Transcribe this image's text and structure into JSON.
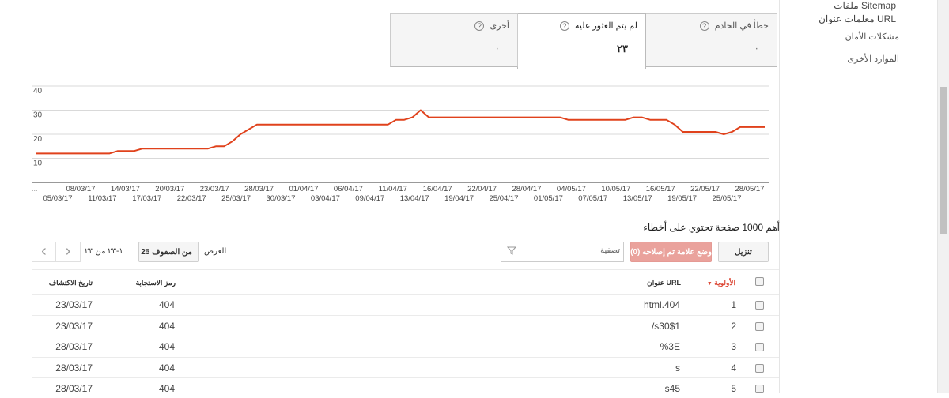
{
  "sidebar": {
    "items": [
      {
        "label": "ملفات Sitemap"
      },
      {
        "label": "معلمات عنوان URL"
      },
      {
        "label": "مشكلات الأمان"
      },
      {
        "label": "الموارد الأخرى"
      }
    ]
  },
  "tabs": [
    {
      "label": "خطأ في الخادم",
      "value": "٠",
      "selected": false
    },
    {
      "label": "لم يتم العثور عليه",
      "value": "٢٣",
      "selected": true
    },
    {
      "label": "أخرى",
      "value": "٠",
      "selected": false
    }
  ],
  "help_glyph": "?",
  "chart_data": {
    "type": "line",
    "color": "#e0421c",
    "ylim": [
      0,
      40
    ],
    "yticks": [
      "10",
      "20",
      "30",
      "40"
    ],
    "grid": true,
    "x_ellipsis": "...",
    "xticks_top": [
      "08/03/17",
      "14/03/17",
      "20/03/17",
      "23/03/17",
      "28/03/17",
      "01/04/17",
      "06/04/17",
      "11/04/17",
      "16/04/17",
      "22/04/17",
      "28/04/17",
      "04/05/17",
      "10/05/17",
      "16/05/17",
      "22/05/17",
      "28/05/17"
    ],
    "xticks_bottom": [
      "05/03/17",
      "11/03/17",
      "17/03/17",
      "22/03/17",
      "25/03/17",
      "30/03/17",
      "03/04/17",
      "09/04/17",
      "13/04/17",
      "19/04/17",
      "25/04/17",
      "01/05/17",
      "07/05/17",
      "13/05/17",
      "19/05/17",
      "25/05/17"
    ],
    "points": [
      {
        "date": "03/03/17",
        "value": 12
      },
      {
        "date": "12/03/17",
        "value": 12
      },
      {
        "date": "13/03/17",
        "value": 13
      },
      {
        "date": "15/03/17",
        "value": 13
      },
      {
        "date": "16/03/17",
        "value": 14
      },
      {
        "date": "24/03/17",
        "value": 14
      },
      {
        "date": "25/03/17",
        "value": 15
      },
      {
        "date": "26/03/17",
        "value": 15
      },
      {
        "date": "27/03/17",
        "value": 17
      },
      {
        "date": "28/03/17",
        "value": 20
      },
      {
        "date": "30/03/17",
        "value": 24
      },
      {
        "date": "15/04/17",
        "value": 24
      },
      {
        "date": "16/04/17",
        "value": 26
      },
      {
        "date": "17/04/17",
        "value": 26
      },
      {
        "date": "18/04/17",
        "value": 27
      },
      {
        "date": "19/04/17",
        "value": 30
      },
      {
        "date": "20/04/17",
        "value": 27
      },
      {
        "date": "06/05/17",
        "value": 27
      },
      {
        "date": "07/05/17",
        "value": 26
      },
      {
        "date": "14/05/17",
        "value": 26
      },
      {
        "date": "15/05/17",
        "value": 27
      },
      {
        "date": "16/05/17",
        "value": 27
      },
      {
        "date": "17/05/17",
        "value": 26
      },
      {
        "date": "19/05/17",
        "value": 26
      },
      {
        "date": "20/05/17",
        "value": 24
      },
      {
        "date": "21/05/17",
        "value": 21
      },
      {
        "date": "25/05/17",
        "value": 21
      },
      {
        "date": "26/05/17",
        "value": 20
      },
      {
        "date": "27/05/17",
        "value": 21
      },
      {
        "date": "28/05/17",
        "value": 23
      },
      {
        "date": "31/05/17",
        "value": 23
      }
    ]
  },
  "list_title": "أهم 1000 صفحة تحتوي على أخطاء",
  "toolbar": {
    "download_label": "تنزيل",
    "mark_fixed_label": "وضع علامة تم إصلاحه (0)",
    "filter_placeholder": "تصفية",
    "show_label": "العرض",
    "rows_select_value": "25 من الصفوف",
    "range_text": "١-٢٣ من ٢٣",
    "prev": "‹",
    "next": "›"
  },
  "table": {
    "headers": {
      "priority": "الأولوية",
      "url": "عنوان URL",
      "response_code": "رمز الاستجابة",
      "detected": "تاريخ الاكتشاف"
    },
    "rows": [
      {
        "priority": "1",
        "url": "html.404",
        "response_code": "404",
        "detected": "23/03/17"
      },
      {
        "priority": "2",
        "url": "/s30$1",
        "response_code": "404",
        "detected": "23/03/17"
      },
      {
        "priority": "3",
        "url": "%3E",
        "response_code": "404",
        "detected": "28/03/17"
      },
      {
        "priority": "4",
        "url": "s",
        "response_code": "404",
        "detected": "28/03/17"
      },
      {
        "priority": "5",
        "url": "s45",
        "response_code": "404",
        "detected": "28/03/17"
      }
    ]
  }
}
